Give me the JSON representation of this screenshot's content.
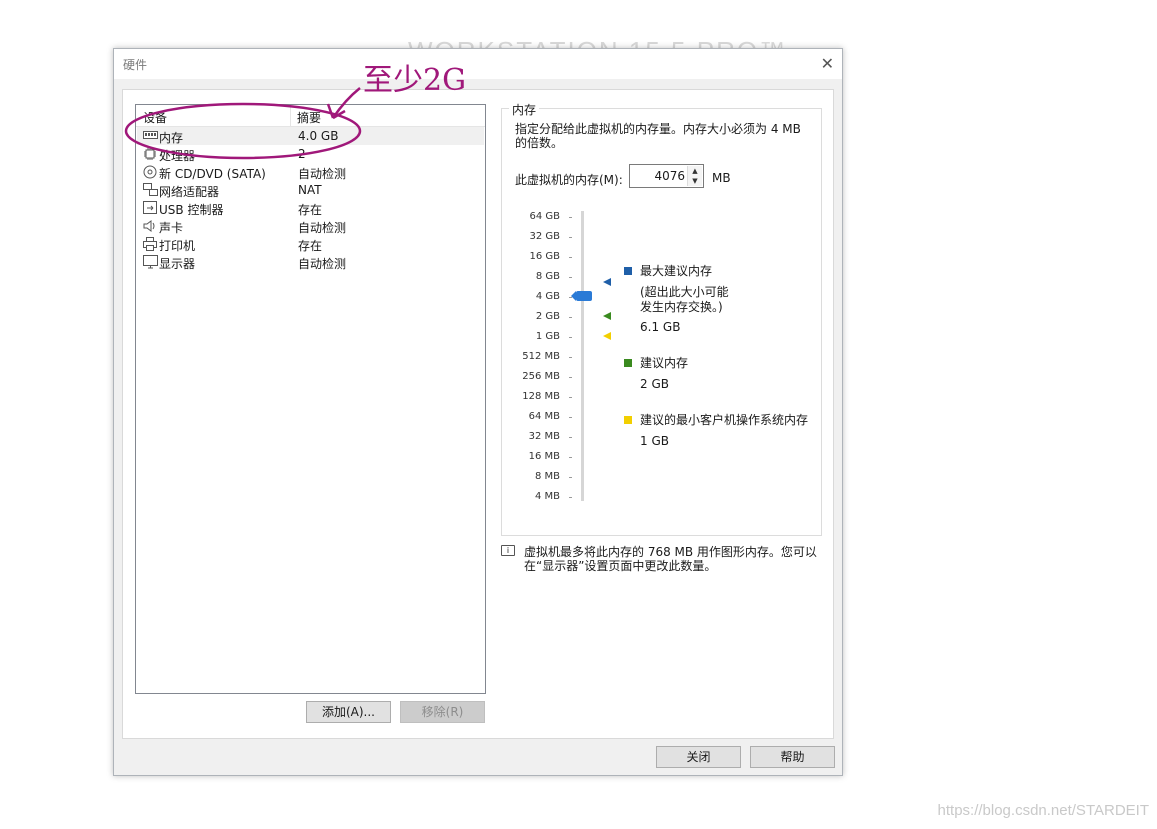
{
  "background_logo": "WORKSTATION 15.5 PRO™",
  "dialog": {
    "title": "硬件",
    "close_glyph": "✕"
  },
  "device_list": {
    "headers": {
      "device": "设备",
      "summary": "摘要"
    },
    "rows": [
      {
        "name": "内存",
        "summary": "4.0 GB",
        "icon": "memory-icon",
        "selected": true
      },
      {
        "name": "处理器",
        "summary": "2",
        "icon": "processor-icon"
      },
      {
        "name": "新 CD/DVD (SATA)",
        "summary": "自动检测",
        "icon": "cd-dvd-icon"
      },
      {
        "name": "网络适配器",
        "summary": "NAT",
        "icon": "network-adapter-icon"
      },
      {
        "name": "USB 控制器",
        "summary": "存在",
        "icon": "usb-icon"
      },
      {
        "name": "声卡",
        "summary": "自动检测",
        "icon": "sound-card-icon"
      },
      {
        "name": "打印机",
        "summary": "存在",
        "icon": "printer-icon"
      },
      {
        "name": "显示器",
        "summary": "自动检测",
        "icon": "display-icon"
      }
    ]
  },
  "buttons": {
    "add": "添加(A)...",
    "remove": "移除(R)",
    "close": "关闭",
    "help": "帮助"
  },
  "memory_panel": {
    "title": "内存",
    "description_line1": "指定分配给此虚拟机的内存量。内存大小必须为 4 MB",
    "description_line2": "的倍数。",
    "field_label": "此虚拟机的内存(M):",
    "field_value": "4076",
    "unit": "MB",
    "scale_labels": [
      "64 GB",
      "32 GB",
      "16 GB",
      "8 GB",
      "4 GB",
      "2 GB",
      "1 GB",
      "512 MB",
      "256 MB",
      "128 MB",
      "64 MB",
      "32 MB",
      "16 MB",
      "8 MB",
      "4 MB"
    ],
    "slider_value": "4 GB",
    "legend": {
      "max": {
        "title": "最大建议内存",
        "note_line1": "(超出此大小可能",
        "note_line2": "发生内存交换。)",
        "value": "6.1 GB",
        "color": "#1f5fa8"
      },
      "recommended": {
        "title": "建议内存",
        "value": "2 GB",
        "color": "#3a8a1f"
      },
      "min_guest": {
        "title": "建议的最小客户机操作系统内存",
        "value": "1 GB",
        "color": "#f2cf00"
      }
    },
    "info_line1": "虚拟机最多将此内存的 768 MB 用作图形内存。您可以",
    "info_line2": "在“显示器”设置页面中更改此数量。"
  },
  "annotation": {
    "text": "至少2G",
    "color": "#a0187a"
  },
  "watermark": "https://blog.csdn.net/STARDEIT"
}
